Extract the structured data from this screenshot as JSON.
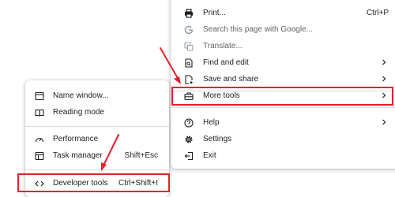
{
  "main_menu": {
    "print": {
      "label": "Print...",
      "shortcut": "Ctrl+P",
      "icon": "printer-icon"
    },
    "search_page": {
      "label": "Search this page with Google...",
      "icon": "google-g-icon"
    },
    "translate": {
      "label": "Translate...",
      "icon": "translate-icon"
    },
    "find_edit": {
      "label": "Find and edit",
      "icon": "find-in-page-icon"
    },
    "save_share": {
      "label": "Save and share",
      "icon": "save-page-icon"
    },
    "more_tools": {
      "label": "More tools",
      "icon": "toolbox-icon"
    },
    "help": {
      "label": "Help",
      "icon": "help-circle-icon"
    },
    "settings": {
      "label": "Settings",
      "icon": "gear-icon"
    },
    "exit": {
      "label": "Exit",
      "icon": "exit-icon"
    }
  },
  "sub_menu": {
    "name_window": {
      "label": "Name window...",
      "icon": "window-icon"
    },
    "reading_mode": {
      "label": "Reading mode",
      "icon": "book-icon"
    },
    "performance": {
      "label": "Performance",
      "icon": "speedometer-icon"
    },
    "task_manager": {
      "label": "Task manager",
      "shortcut": "Shift+Esc",
      "icon": "task-manager-icon"
    },
    "developer_tools": {
      "label": "Developer tools",
      "shortcut": "Ctrl+Shift+I",
      "icon": "code-brackets-icon"
    }
  },
  "colors": {
    "highlight": "#e8202a",
    "text": "#1f1f1f",
    "disabled_text": "#5f6368",
    "divider": "#dadce0"
  }
}
